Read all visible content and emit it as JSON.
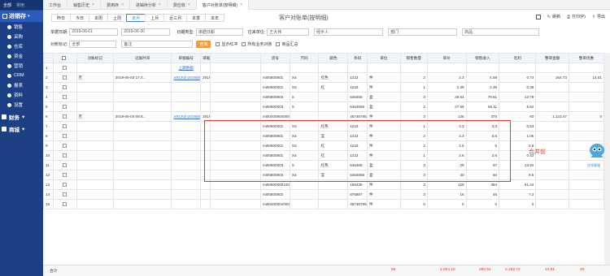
{
  "sidebar": {
    "top_tabs": [
      "全部",
      "常用"
    ],
    "head": "进销存",
    "items": [
      "销售",
      "采购",
      "仓库",
      "资金",
      "营销",
      "CRM",
      "报表",
      "资料",
      "设置"
    ],
    "groups": [
      "财务",
      "商城"
    ]
  },
  "tabs": [
    {
      "label": "工作台",
      "closable": false
    },
    {
      "label": "销售历史",
      "closable": true
    },
    {
      "label": "费用存",
      "closable": true
    },
    {
      "label": "进销存分析",
      "closable": true
    },
    {
      "label": "费应收",
      "closable": true
    },
    {
      "label": "客户对账单(按明细)",
      "closable": true,
      "active": true
    }
  ],
  "date_buttons": [
    "昨日",
    "今日",
    "本周",
    "上周",
    "本月",
    "上月",
    "近三月",
    "本季",
    "本年"
  ],
  "active_date": "本月",
  "page_title": "客户对账单(按明细)",
  "tools": [
    "刷新",
    "打印(P)",
    "导出"
  ],
  "filters": {
    "date_label": "单据日期:",
    "date_from": "2019-06-01",
    "date_to": "2019-06-30",
    "type_label": "日期类型:",
    "type_value": "单据日期",
    "customer_label": "往来单位:",
    "customer_value": "王大伟",
    "handler_value": "经手人",
    "dept_value": "部门",
    "goods_value": "商品",
    "mark_label": "对账标记:",
    "mark_value": "全部",
    "note_value": "备注",
    "query": "查询",
    "checks": [
      "显示红冲",
      "所有业务对账",
      "商品汇总"
    ]
  },
  "columns": [
    "",
    "对账标记",
    "记账时间",
    "单据编号",
    "单据日期",
    "货号",
    "尺码",
    "颜色",
    "条码",
    "单位",
    "销售数量",
    "单价",
    "销售收入",
    "毛利",
    "整单金额",
    "整单优惠",
    "整单费用"
  ],
  "rows": [
    [
      "1",
      "",
      "",
      "上期余额",
      "",
      "",
      "",
      "",
      "",
      "",
      "",
      "",
      "",
      "",
      "",
      "",
      ""
    ],
    [
      "2",
      "否",
      "2019-06-03 17:4...",
      "XSCKD-20190603-001",
      "2019-06-03",
      "mi00500001",
      "XS",
      "红色",
      "1233",
      "件",
      "2",
      "2.3",
      "4.59",
      "0.74",
      "164.73",
      "14.61",
      "20.00"
    ],
    [
      "3",
      "",
      "",
      "",
      "",
      "mi00500001",
      "XS",
      "红",
      "1233",
      "件",
      "1",
      "2.39",
      "2.39",
      "0.38",
      "",
      "",
      ""
    ],
    [
      "4",
      "",
      "",
      "",
      "",
      "mi00500003",
      "S",
      "",
      "546465",
      "盒",
      "3",
      "26.64",
      "79.91",
      "12.79",
      "",
      "",
      ""
    ],
    [
      "5",
      "",
      "",
      "",
      "",
      "mi00500003",
      "S",
      "",
      "5464655",
      "盒",
      "2",
      "27.56",
      "55.11",
      "8.82",
      "",
      "",
      ""
    ],
    [
      "6",
      "否",
      "2019-06-04 09:5...",
      "XSCKD-20190604-001",
      "2019-06-04",
      "mi0040000400009",
      "",
      "",
      "4574878544",
      "件",
      "3",
      "125",
      "375",
      "60",
      "1,123.47",
      "0",
      "0.00"
    ],
    [
      "7",
      "",
      "",
      "",
      "",
      "mi00500001",
      "XS",
      "红色",
      "1233",
      "件",
      "1",
      "3.3",
      "3.3",
      "0.53",
      "",
      "",
      ""
    ],
    [
      "8",
      "",
      "",
      "",
      "",
      "mi00500001",
      "XS",
      "蓝",
      "1233",
      "件",
      "2",
      "3.3",
      "6.6",
      "1.06",
      "",
      "",
      ""
    ],
    [
      "9",
      "",
      "",
      "",
      "",
      "mi00500001",
      "XS",
      "红",
      "1233",
      "件",
      "2",
      "2.5",
      "5",
      "0.8",
      "",
      "",
      ""
    ],
    [
      "10",
      "",
      "",
      "",
      "",
      "mi00500001",
      "XS",
      "红",
      "1233",
      "件",
      "1",
      "2.6",
      "2.6",
      "0.42",
      "",
      "",
      ""
    ],
    [
      "11",
      "",
      "",
      "",
      "",
      "mi00500003",
      "S",
      "红色",
      "546465",
      "盒",
      "3",
      "29",
      "87",
      "13.92",
      "",
      "",
      ""
    ],
    [
      "12",
      "",
      "",
      "",
      "",
      "mi00500003",
      "XS",
      "蓝",
      "5464655",
      "盒",
      "3",
      "30",
      "60",
      "9.6",
      "",
      "",
      ""
    ],
    [
      "13",
      "",
      "",
      "",
      "",
      "mi00500000100004",
      "",
      "",
      "156235",
      "件",
      "3",
      "128",
      "384",
      "61.44",
      "",
      "",
      ""
    ],
    [
      "14",
      "",
      "",
      "",
      "",
      "mi00500002",
      "",
      "",
      "876887",
      "件",
      "3",
      "15",
      "45",
      "7.2",
      "",
      "",
      ""
    ],
    [
      "15",
      "",
      "",
      "",
      "",
      "mi0040000400009",
      "",
      "",
      "4574878544",
      "件",
      "0",
      "0",
      "0",
      "0",
      "",
      "",
      ""
    ]
  ],
  "merge_label": "合并前",
  "mascot_label": "在线客服",
  "footer": {
    "label": "合计",
    "qty": "55",
    "income": "1,064.15",
    "profit": "280.54",
    "total": "2,182.72",
    "discount": "14.61",
    "fee": "40"
  }
}
